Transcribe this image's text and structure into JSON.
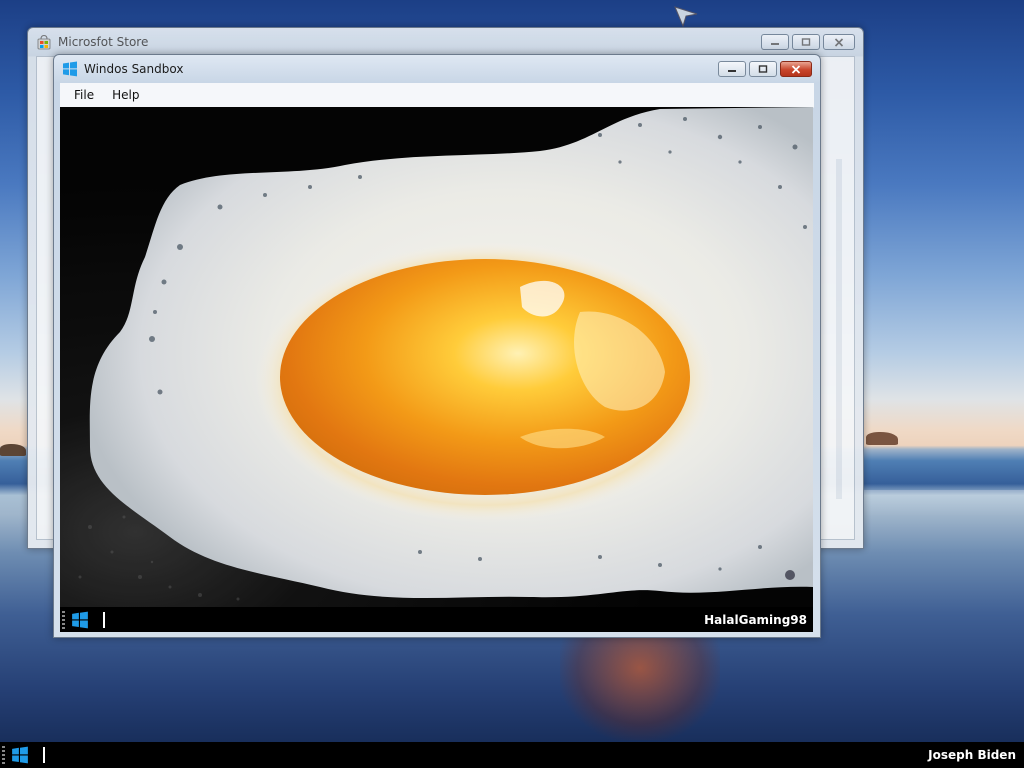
{
  "desktop": {
    "background": "beach-sunset-wallpaper",
    "accent_colors": {
      "sky_top": "#1c3f86",
      "horizon": "#eed3bd",
      "sea": "#365f9a",
      "taskbar": "#000000",
      "windows_logo": "#1f9be8",
      "close_button": "#c9462c"
    }
  },
  "store_window": {
    "title": "Microsfot Store",
    "icon": "store-bag-icon",
    "controls": [
      "minimize-icon",
      "maximize-icon",
      "close-icon"
    ]
  },
  "sandbox_window": {
    "title": "Windos Sandbox",
    "icon": "windows-logo-icon",
    "menu": {
      "file": "File",
      "help": "Help"
    },
    "controls": [
      "minimize-icon",
      "maximize-icon",
      "close-icon"
    ],
    "screen": {
      "wallpaper": "fried-egg-image",
      "taskbar": {
        "start_icon": "windows-logo-icon",
        "username": "HalalGaming98"
      }
    }
  },
  "host_taskbar": {
    "start_icon": "windows-logo-icon",
    "username": "Joseph Biden"
  }
}
